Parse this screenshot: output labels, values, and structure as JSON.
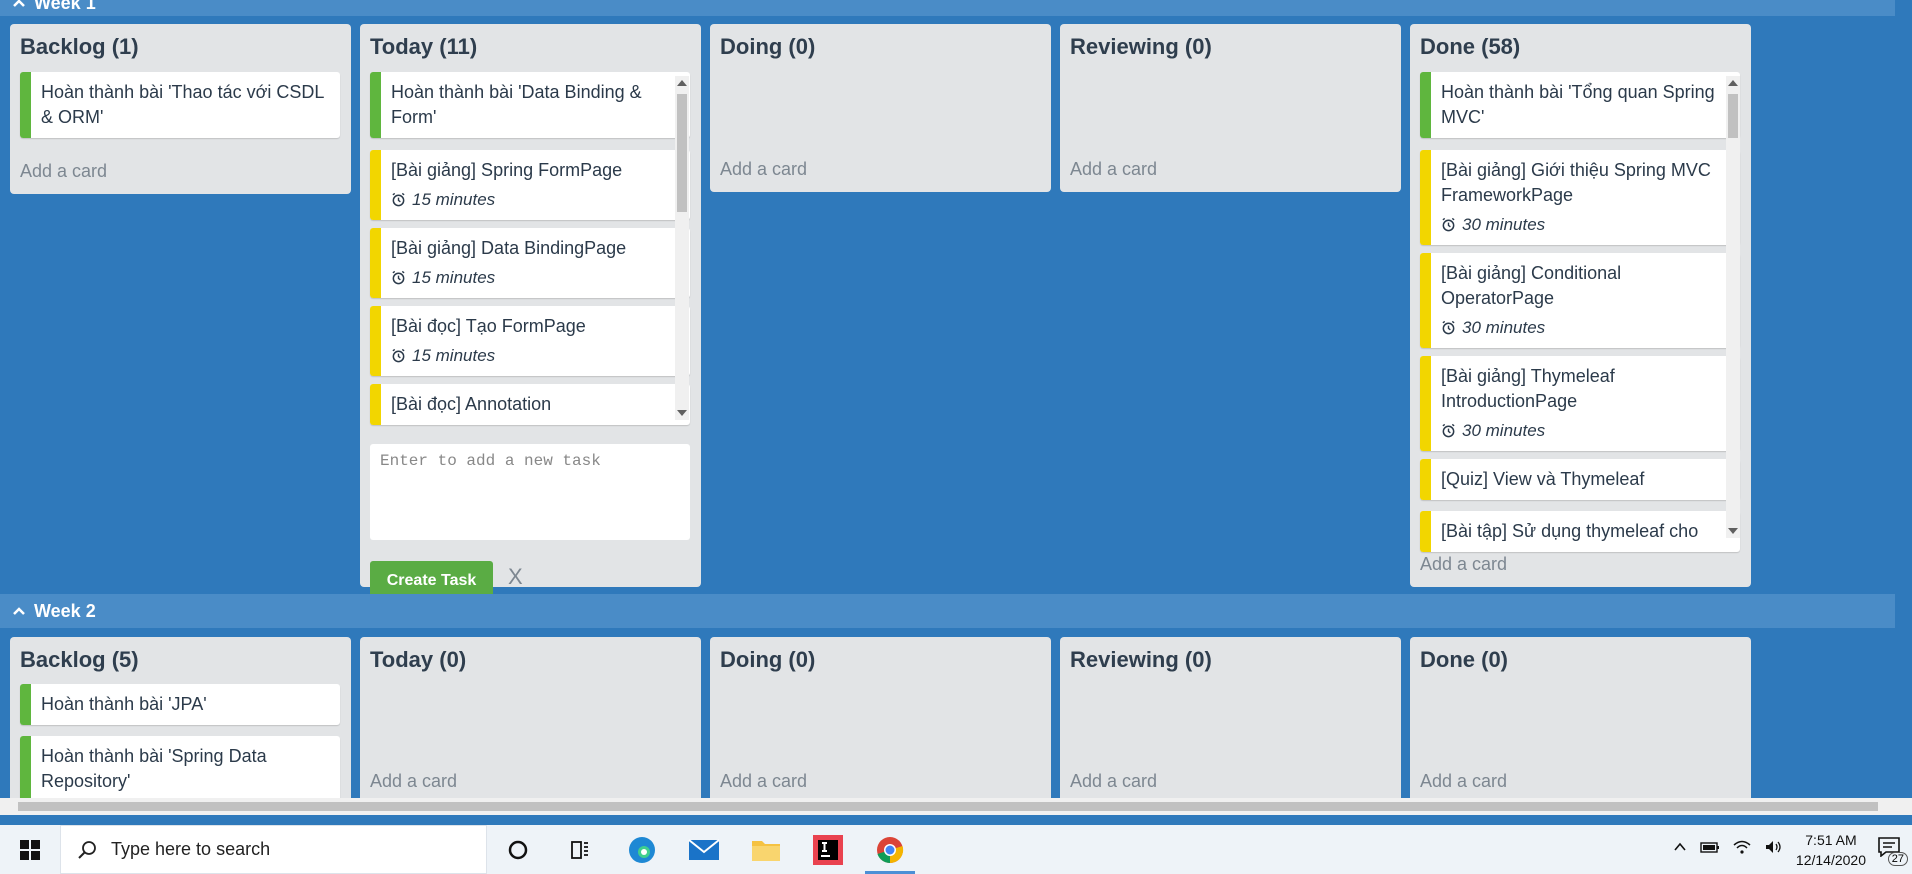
{
  "weeks": [
    {
      "label": "Week 1",
      "lists": [
        {
          "title": "Backlog (1)",
          "cards": [
            {
              "text": "Hoàn thành bài 'Thao tác với CSDL & ORM'",
              "color": "green"
            }
          ],
          "add_card": "Add a card"
        },
        {
          "title": "Today (11)",
          "cards": [
            {
              "text": "Hoàn thành bài 'Data Binding & Form'",
              "color": "green"
            },
            {
              "text": "[Bài giảng] Spring FormPage",
              "meta": "15 minutes",
              "color": "yellow"
            },
            {
              "text": "[Bài giảng] Data BindingPage",
              "meta": "15 minutes",
              "color": "yellow"
            },
            {
              "text": "[Bài đọc] Tạo FormPage",
              "meta": "15 minutes",
              "color": "yellow"
            },
            {
              "text": "[Bài đọc] Annotation",
              "color": "yellow"
            }
          ],
          "new_task_placeholder": "Enter to add a new task",
          "create_button": "Create Task",
          "cancel": "X"
        },
        {
          "title": "Doing (0)",
          "cards": [],
          "add_card": "Add a card"
        },
        {
          "title": "Reviewing (0)",
          "cards": [],
          "add_card": "Add a card"
        },
        {
          "title": "Done (58)",
          "cards": [
            {
              "text": "Hoàn thành bài 'Tổng quan Spring MVC'",
              "color": "green"
            },
            {
              "text": "[Bài giảng] Giới thiệu Spring MVC FrameworkPage",
              "meta": "30 minutes",
              "color": "yellow"
            },
            {
              "text": "[Bài giảng] Conditional OperatorPage",
              "meta": "30 minutes",
              "color": "yellow"
            },
            {
              "text": "[Bài giảng] Thymeleaf IntroductionPage",
              "meta": "30 minutes",
              "color": "yellow"
            },
            {
              "text": "[Quiz] View và Thymeleaf",
              "color": "yellow"
            },
            {
              "text": "[Bài tập] Sử dụng thymeleaf cho",
              "color": "yellow"
            }
          ],
          "add_card": "Add a card"
        }
      ]
    },
    {
      "label": "Week 2",
      "lists": [
        {
          "title": "Backlog (5)",
          "cards": [
            {
              "text": "Hoàn thành bài 'JPA'",
              "color": "green"
            },
            {
              "text": "Hoàn thành bài 'Spring Data Repository'",
              "color": "green"
            }
          ],
          "add_card": "Add a card"
        },
        {
          "title": "Today (0)",
          "cards": [],
          "add_card": "Add a card"
        },
        {
          "title": "Doing (0)",
          "cards": [],
          "add_card": "Add a card"
        },
        {
          "title": "Reviewing (0)",
          "cards": [],
          "add_card": "Add a card"
        },
        {
          "title": "Done (0)",
          "cards": [],
          "add_card": "Add a card"
        }
      ]
    }
  ],
  "colors": {
    "board_bg": "#2f79bb",
    "green_label": "#5fb63e",
    "yellow_label": "#f2d600",
    "create_button": "#5aac44"
  },
  "taskbar": {
    "search_placeholder": "Type here to search",
    "apps": [
      "cortana-icon",
      "task-view-icon",
      "edge-icon",
      "mail-icon",
      "file-explorer-icon",
      "intellij-icon",
      "chrome-icon"
    ],
    "time": "7:51 AM",
    "date": "12/14/2020",
    "notification_count": "27"
  }
}
